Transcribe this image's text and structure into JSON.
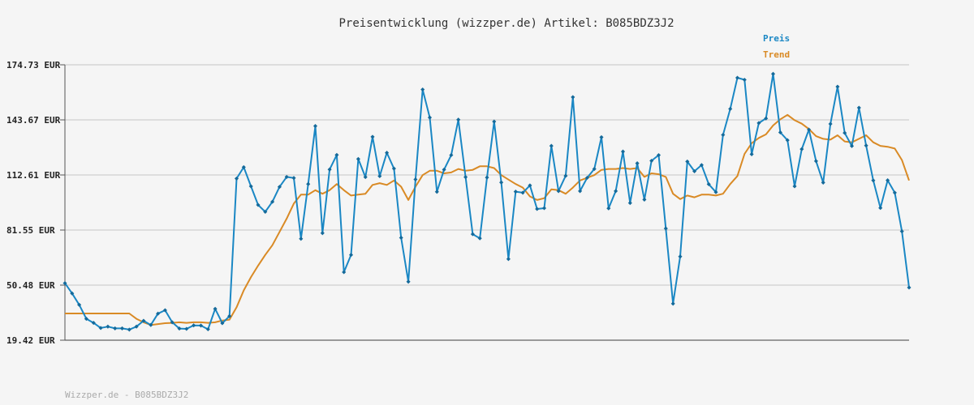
{
  "chart_data": {
    "type": "line",
    "title": "Preisentwicklung (wizzper.de) Artikel: B085BDZ3J2",
    "xlabel": "",
    "ylabel": "",
    "y_ticks": [
      "174.73 EUR",
      "143.67 EUR",
      "112.61 EUR",
      "81.55 EUR",
      "50.48 EUR",
      "19.42 EUR"
    ],
    "y_tick_values": [
      174.73,
      143.67,
      112.61,
      81.55,
      50.48,
      19.42
    ],
    "ylim": [
      19.42,
      174.73
    ],
    "grid": true,
    "legend_position": "top-right",
    "series": [
      {
        "name": "Preis",
        "color": "#1a87c4",
        "values": [
          51.6,
          45.8,
          39.4,
          31.5,
          29.2,
          26.3,
          27.1,
          26.1,
          26.1,
          25.4,
          27.1,
          30.4,
          28.0,
          34.4,
          36.3,
          29.5,
          26.0,
          25.8,
          27.8,
          27.7,
          25.6,
          37.1,
          29.0,
          33.0,
          110.6,
          117.0,
          106.2,
          95.7,
          91.8,
          97.5,
          105.9,
          111.5,
          110.9,
          76.6,
          107.5,
          140.2,
          79.8,
          115.7,
          123.9,
          57.8,
          67.5,
          121.6,
          111.4,
          134.1,
          111.9,
          125.1,
          116.2,
          77.2,
          52.4,
          110.1,
          160.8,
          145.0,
          103.1,
          115.6,
          123.8,
          143.8,
          111.4,
          79.2,
          76.9,
          111.2,
          142.7,
          108.4,
          65.2,
          103.2,
          102.6,
          106.7,
          93.4,
          93.9,
          129.0,
          103.5,
          112.1,
          156.5,
          103.5,
          111.0,
          116.0,
          133.9,
          93.8,
          103.5,
          125.8,
          96.8,
          119.2,
          98.7,
          120.6,
          123.8,
          82.4,
          40.0,
          66.6,
          120.2,
          114.7,
          118.2,
          107.4,
          102.9,
          135.2,
          149.9,
          167.4,
          166.3,
          124.3,
          141.9,
          144.5,
          169.6,
          136.6,
          132.2,
          106.2,
          127.2,
          138.2,
          120.4,
          108.3,
          141.4,
          162.4,
          136.3,
          128.9,
          150.5,
          129.2,
          109.5,
          94.0,
          109.6,
          102.6,
          80.8,
          49.1
        ]
      },
      {
        "name": "Trend",
        "color": "#d98a25",
        "values": [
          34.5,
          34.5,
          34.5,
          34.5,
          34.5,
          34.5,
          34.5,
          34.5,
          34.5,
          34.5,
          31.5,
          29.5,
          28.0,
          28.5,
          29.0,
          29.2,
          29.5,
          29.2,
          29.5,
          29.5,
          29.2,
          29.5,
          30.5,
          31.0,
          38.0,
          47.5,
          55.0,
          61.5,
          67.5,
          73.0,
          80.5,
          88.0,
          96.5,
          101.5,
          101.5,
          104.0,
          102.0,
          104.0,
          107.5,
          104.0,
          101.0,
          101.5,
          102.0,
          107.0,
          108.0,
          107.0,
          109.5,
          106.0,
          98.5,
          106.0,
          112.5,
          115.0,
          115.0,
          113.5,
          114.0,
          116.0,
          115.0,
          115.5,
          117.5,
          117.5,
          116.5,
          112.5,
          110.0,
          107.5,
          105.5,
          100.5,
          98.5,
          99.5,
          104.5,
          104.0,
          102.0,
          105.5,
          109.5,
          111.0,
          112.5,
          115.5,
          116.0,
          116.0,
          116.5,
          116.0,
          116.5,
          111.5,
          113.5,
          113.0,
          111.5,
          102.0,
          99.0,
          101.0,
          100.0,
          101.5,
          101.5,
          101.0,
          102.0,
          107.5,
          112.0,
          124.5,
          130.5,
          133.5,
          135.5,
          140.5,
          144.0,
          146.5,
          143.5,
          141.5,
          138.5,
          134.5,
          133.0,
          132.5,
          135.0,
          131.5,
          131.0,
          133.0,
          135.0,
          131.0,
          129.0,
          128.5,
          127.5,
          121.0,
          109.5
        ]
      }
    ]
  },
  "footer_text": "Wizzper.de - B085BDZ3J2",
  "colors": {
    "background": "#f5f5f5",
    "grid": "#dddddd",
    "axis": "#555555",
    "preis": "#1a87c4",
    "trend": "#d98a25"
  }
}
